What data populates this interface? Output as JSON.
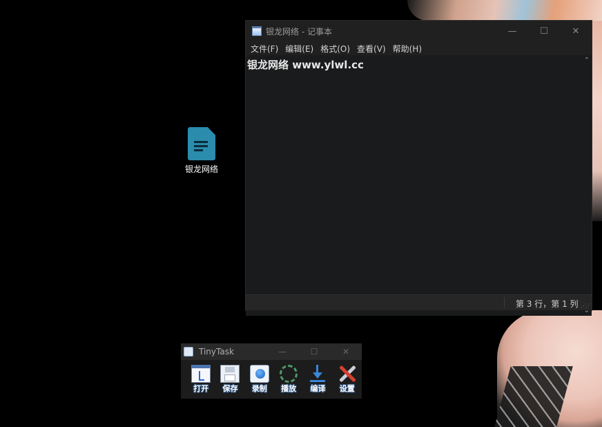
{
  "desktop": {
    "icons": [
      {
        "label": "银龙网络",
        "icon": "document-icon"
      }
    ]
  },
  "notepad": {
    "title": "银龙网络 - 记事本",
    "controls": {
      "minimize": "—",
      "maximize": "☐",
      "close": "✕"
    },
    "menu": [
      "文件(F)",
      "编辑(E)",
      "格式(O)",
      "查看(V)",
      "帮助(H)"
    ],
    "content": "银龙网络 www.ylwl.cc",
    "status": {
      "position": "第 3 行，第 1 列"
    },
    "theme": {
      "editor_bg": "#1a1b1c",
      "title_bg": "#202020"
    }
  },
  "tinytask": {
    "title": "TinyTask",
    "controls": {
      "minimize": "—",
      "maximize": "☐",
      "close": "✕"
    },
    "tools": [
      {
        "label": "打开",
        "icon": "open-icon"
      },
      {
        "label": "保存",
        "icon": "save-icon"
      },
      {
        "label": "录制",
        "icon": "record-icon"
      },
      {
        "label": "播放",
        "icon": "play-icon"
      },
      {
        "label": "编译",
        "icon": "compile-icon"
      },
      {
        "label": "设置",
        "icon": "settings-icon"
      }
    ]
  }
}
